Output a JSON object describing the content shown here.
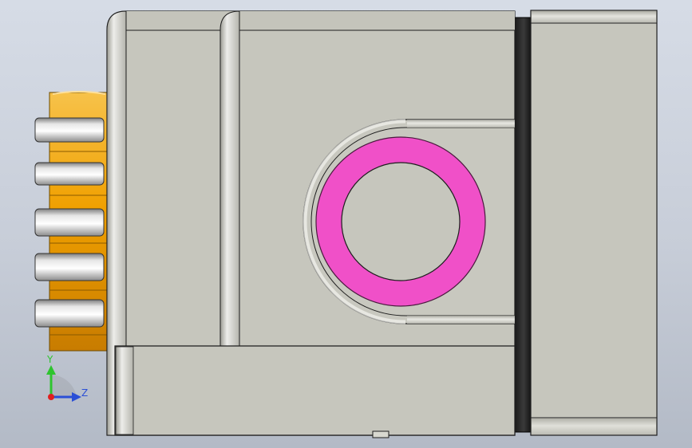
{
  "viewport": {
    "axes": {
      "y_label": "Y",
      "z_label": "Z",
      "y_color": "#2ec42e",
      "z_color": "#2b4fd6",
      "x_color": "#e01f1f"
    },
    "colors": {
      "body": "#c6c6bd",
      "outline": "#2a2a2a",
      "selected_face": "#f050c8",
      "pin_gold": "#f2a400",
      "band_silver": "#b9b9b9",
      "rear_block": "#111111"
    }
  }
}
